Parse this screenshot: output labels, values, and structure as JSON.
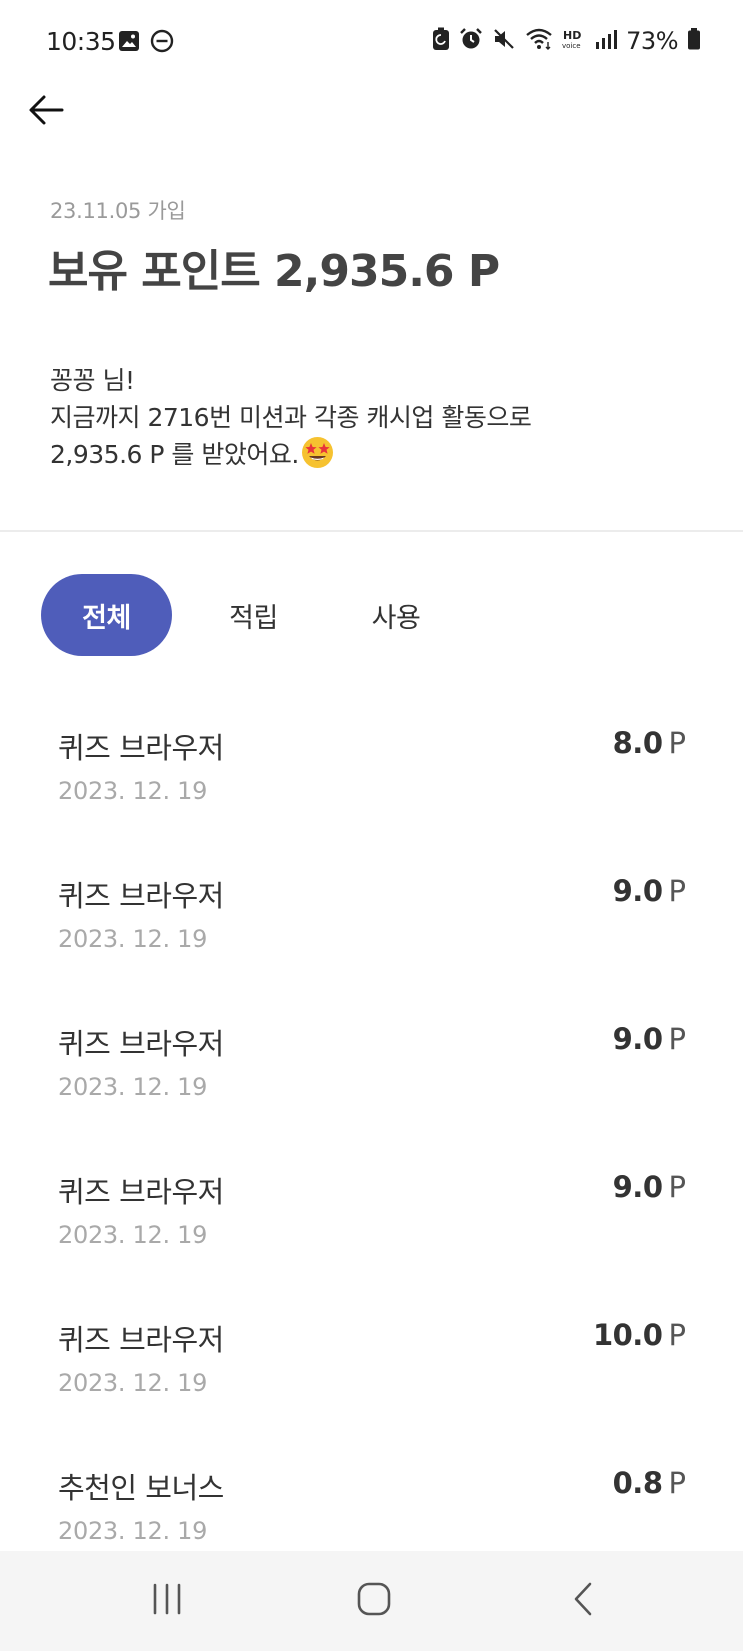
{
  "status_bar": {
    "time": "10:35",
    "battery": "73%",
    "icons_left": [
      "gallery-icon",
      "dnd-icon"
    ],
    "icons_right": [
      "battery-saver-icon",
      "alarm-icon",
      "mute-icon",
      "wifi-icon",
      "hd-voice-icon",
      "signal-icon",
      "battery-icon"
    ]
  },
  "header": {
    "join_date": "23.11.05 가입",
    "points_title": "보유 포인트 2,935.6 P",
    "intro_line1": "꽁꽁 님!",
    "intro_line2": "지금까지 2716번 미션과 각종 캐시업 활동으로",
    "intro_line3": "2,935.6 P 를 받았어요.",
    "emoji": "star-struck-emoji"
  },
  "tabs": [
    {
      "label": "전체",
      "active": true
    },
    {
      "label": "적립",
      "active": false
    },
    {
      "label": "사용",
      "active": false
    }
  ],
  "history": [
    {
      "title": "퀴즈 브라우저",
      "date": "2023. 12. 19",
      "amount": "8.0",
      "unit": "P"
    },
    {
      "title": "퀴즈 브라우저",
      "date": "2023. 12. 19",
      "amount": "9.0",
      "unit": "P"
    },
    {
      "title": "퀴즈 브라우저",
      "date": "2023. 12. 19",
      "amount": "9.0",
      "unit": "P"
    },
    {
      "title": "퀴즈 브라우저",
      "date": "2023. 12. 19",
      "amount": "9.0",
      "unit": "P"
    },
    {
      "title": "퀴즈 브라우저",
      "date": "2023. 12. 19",
      "amount": "10.0",
      "unit": "P"
    },
    {
      "title": "추천인 보너스",
      "date": "2023. 12. 19",
      "amount": "0.8",
      "unit": "P"
    }
  ],
  "colors": {
    "accent": "#4f5dba",
    "text": "#333333",
    "muted": "#a9a9a9"
  }
}
